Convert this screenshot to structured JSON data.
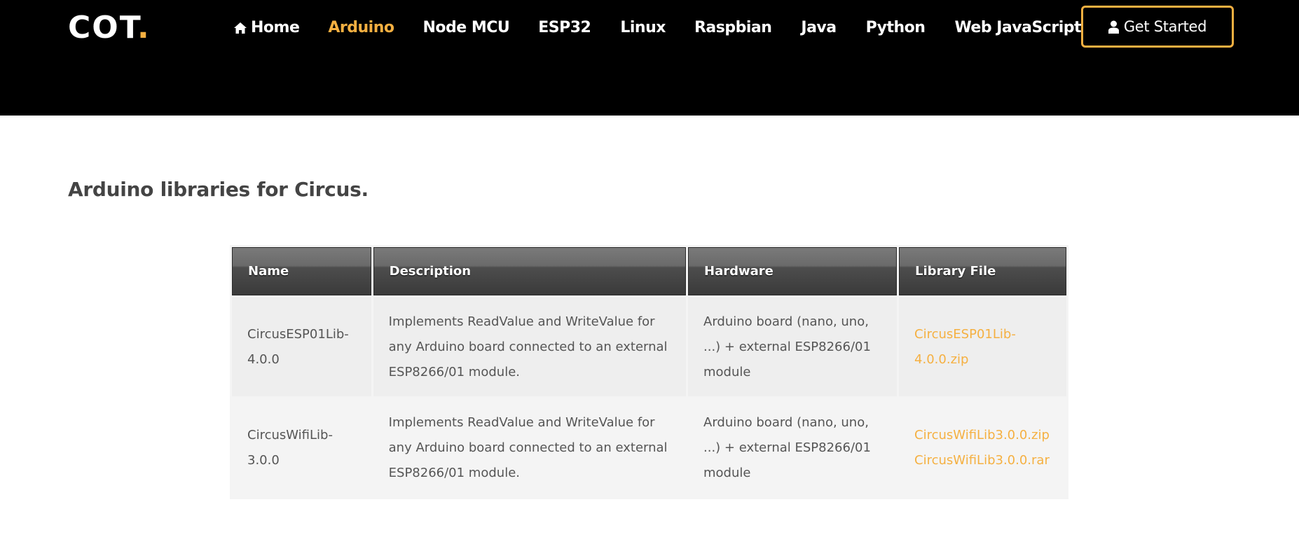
{
  "header": {
    "logo_text": "COT",
    "logo_dot": ".",
    "nav": [
      {
        "label": "Home",
        "icon": "home-icon"
      },
      {
        "label": "Arduino",
        "active": true
      },
      {
        "label": "Node MCU"
      },
      {
        "label": "ESP32"
      },
      {
        "label": "Linux"
      },
      {
        "label": "Raspbian"
      },
      {
        "label": "Java"
      },
      {
        "label": "Python"
      },
      {
        "label": "Web JavaScript"
      }
    ],
    "cta_label": "Get Started",
    "cta_icon": "user-icon"
  },
  "main": {
    "title": "Arduino libraries for Circus.",
    "table": {
      "columns": [
        "Name",
        "Description",
        "Hardware",
        "Library File"
      ],
      "rows": [
        {
          "name": "CircusESP01Lib-4.0.0",
          "description": "Implements ReadValue and WriteValue for any Arduino board connected to an external ESP8266/01 module.",
          "hardware": "Arduino board (nano, uno, ...) + external ESP8266/01 module",
          "files": [
            "CircusESP01Lib-4.0.0.zip"
          ]
        },
        {
          "name": "CircusWifiLib-3.0.0",
          "description": "Implements ReadValue and WriteValue for any Arduino board connected to an external ESP8266/01 module.",
          "hardware": "Arduino board (nano, uno, ...) + external ESP8266/01 module",
          "files": [
            "CircusWifiLib3.0.0.zip",
            "CircusWifiLib3.0.0.rar"
          ]
        }
      ]
    }
  },
  "colors": {
    "accent": "#f5b041",
    "header_bg": "#000000",
    "text": "#555555"
  }
}
